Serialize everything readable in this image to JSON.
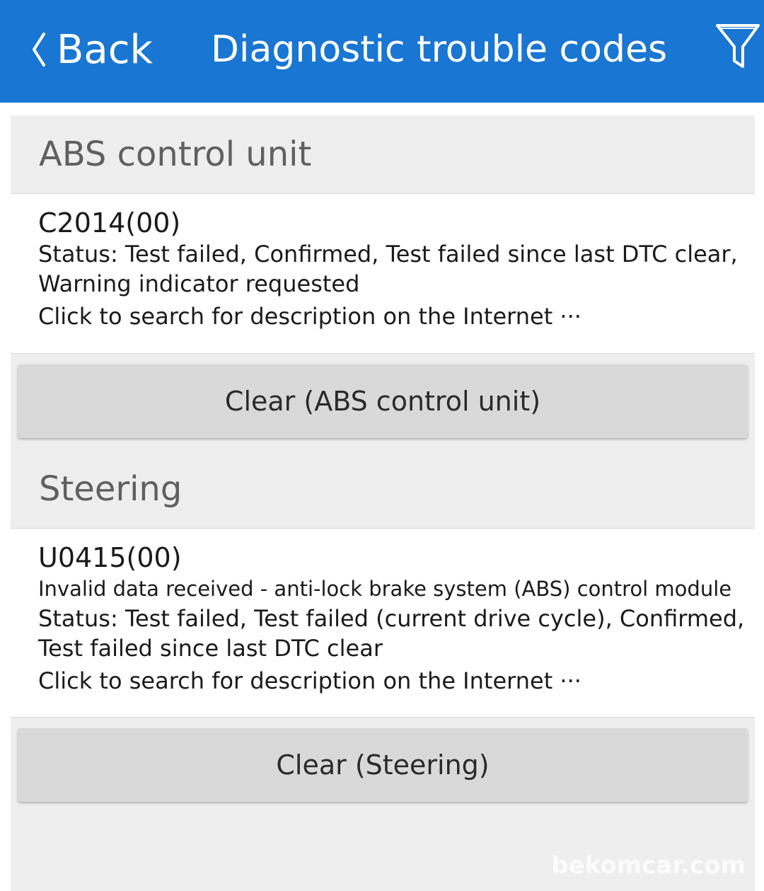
{
  "header": {
    "back_label": "Back",
    "title": "Diagnostic trouble codes",
    "filter_icon": "filter-icon",
    "back_icon": "chevron-left-icon",
    "background_color": "#1976d2"
  },
  "sections": [
    {
      "name": "ABS control unit",
      "dtcs": [
        {
          "code": "C2014(00)",
          "lines": [
            "Status: Test failed, Confirmed, Test failed since last DTC clear,",
            "Warning indicator requested"
          ],
          "link": "Click to search for description on the Internet ···"
        }
      ],
      "clear_label": "Clear (ABS control unit)"
    },
    {
      "name": "Steering",
      "dtcs": [
        {
          "code": "U0415(00)",
          "description": "Invalid data received - anti-lock brake system (ABS) control module",
          "lines": [
            "Status: Test failed, Test failed (current drive cycle), Confirmed,",
            "Test failed since last DTC clear"
          ],
          "link": "Click to search for description on the Internet ···"
        }
      ],
      "clear_label": "Clear (Steering)"
    }
  ],
  "watermark": "bekomcar.com"
}
